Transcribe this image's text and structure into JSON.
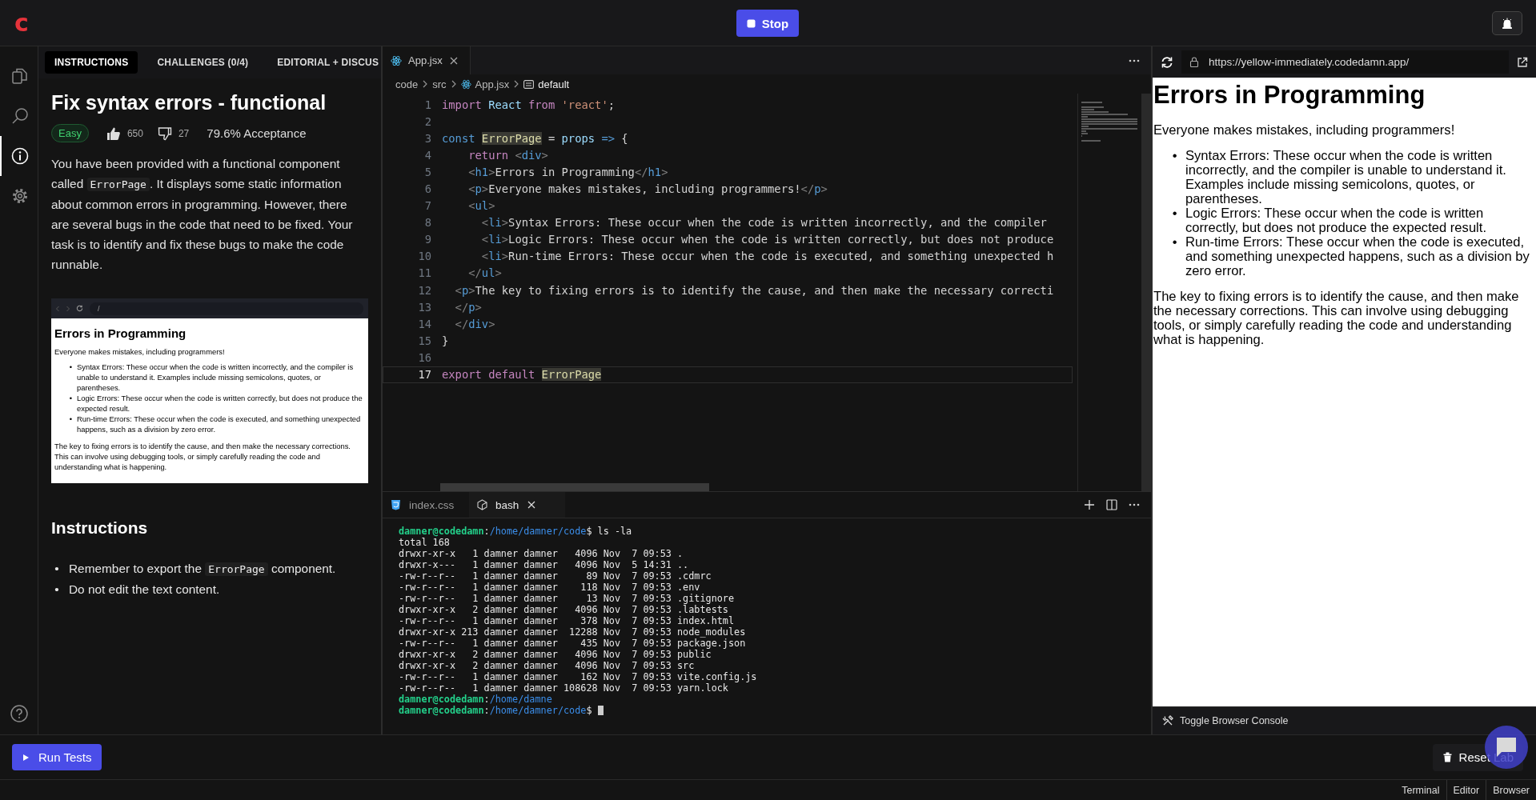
{
  "top_bar": {
    "brand": "c",
    "stop_button": "Stop"
  },
  "sidebar": {
    "items": [
      {
        "kind": "files",
        "selected": false
      },
      {
        "kind": "search",
        "selected": false
      },
      {
        "kind": "info",
        "selected": true
      },
      {
        "kind": "settings",
        "selected": false
      }
    ]
  },
  "instructions_panel": {
    "tabs": [
      {
        "label": "INSTRUCTIONS",
        "selected": true
      },
      {
        "label": "CHALLENGES (0/4)",
        "selected": false
      },
      {
        "label": "EDITORIAL + DISCUS",
        "selected": false
      }
    ],
    "title": "Fix syntax errors - functional",
    "difficulty": "Easy",
    "likes": "650",
    "dislikes": "27",
    "acceptance": "79.6% Acceptance",
    "description": [
      {
        "kind": "text",
        "text": "You have been provided with a functional component called "
      },
      {
        "kind": "code",
        "text": "ErrorPage"
      },
      {
        "kind": "text",
        "text": ". It displays some static information about common errors in programming. However, there are several bugs in the code that need to be fixed. Your task is to identify and fix these bugs to make the code runnable."
      }
    ],
    "screenshot": {
      "url": "/",
      "heading": "Errors in Programming",
      "intro": "Everyone makes mistakes, including programmers!",
      "bullet": "•",
      "items": [
        "Syntax Errors: These occur when the code is written incorrectly, and the compiler is unable to understand it. Examples include missing semicolons, quotes, or parentheses.",
        "Logic Errors: These occur when the code is written correctly, but does not produce the expected result.",
        "Run-time Errors: These occur when the code is executed, and something unexpected happens, such as a division by zero error."
      ],
      "closing": "The key to fixing errors is to identify the cause, and then make the necessary corrections. This can involve using debugging tools, or simply carefully reading the code and understanding what is happening."
    },
    "section_title": "Instructions",
    "step_bullet": "•",
    "steps": [
      [
        {
          "kind": "text",
          "text": "Remember to export the "
        },
        {
          "kind": "code",
          "text": "ErrorPage"
        },
        {
          "kind": "text",
          "text": " component."
        }
      ],
      [
        {
          "kind": "text",
          "text": "Do not edit the text content."
        }
      ]
    ]
  },
  "editor": {
    "tabs": [
      {
        "label": "App.jsx",
        "selected": true
      }
    ],
    "breadcrumb": [
      {
        "kind": "folder",
        "label": "code"
      },
      {
        "kind": "folder",
        "label": "src"
      },
      {
        "kind": "react",
        "label": "App.jsx"
      },
      {
        "kind": "symbol",
        "label": "default"
      }
    ],
    "lines": [
      {
        "number": "1",
        "current": false,
        "tokens": [
          {
            "kind": "kw",
            "text": "import "
          },
          {
            "kind": "var",
            "text": "React "
          },
          {
            "kind": "kw",
            "text": "from "
          },
          {
            "kind": "str",
            "text": "'react'"
          },
          {
            "kind": "text",
            "text": ";"
          }
        ]
      },
      {
        "number": "2",
        "current": false
      },
      {
        "number": "3",
        "current": false,
        "tokens": [
          {
            "kind": "decl",
            "text": "const "
          },
          {
            "kind": "hl",
            "text": "ErrorPage"
          },
          {
            "kind": "text",
            "text": " = "
          },
          {
            "kind": "var",
            "text": "props "
          },
          {
            "kind": "decl",
            "text": "=>"
          },
          {
            "kind": "text",
            "text": " {"
          }
        ]
      },
      {
        "number": "4",
        "current": false,
        "tokens": [
          {
            "kind": "kw",
            "text": "    return "
          },
          {
            "kind": "punct",
            "text": "<"
          },
          {
            "kind": "tag",
            "text": "div"
          },
          {
            "kind": "punct",
            "text": ">"
          }
        ]
      },
      {
        "number": "5",
        "current": false,
        "tokens": [
          {
            "kind": "punct",
            "text": "    <"
          },
          {
            "kind": "tag",
            "text": "h1"
          },
          {
            "kind": "punct",
            "text": ">"
          },
          {
            "kind": "text",
            "text": "Errors in Programming"
          },
          {
            "kind": "punct",
            "text": "</"
          },
          {
            "kind": "tag",
            "text": "h1"
          },
          {
            "kind": "punct",
            "text": ">"
          }
        ]
      },
      {
        "number": "6",
        "current": false,
        "tokens": [
          {
            "kind": "punct",
            "text": "    <"
          },
          {
            "kind": "tag",
            "text": "p"
          },
          {
            "kind": "punct",
            "text": ">"
          },
          {
            "kind": "text",
            "text": "Everyone makes mistakes, including programmers!"
          },
          {
            "kind": "punct",
            "text": "</"
          },
          {
            "kind": "tag",
            "text": "p"
          },
          {
            "kind": "punct",
            "text": ">"
          }
        ]
      },
      {
        "number": "7",
        "current": false,
        "tokens": [
          {
            "kind": "punct",
            "text": "    <"
          },
          {
            "kind": "tag",
            "text": "ul"
          },
          {
            "kind": "punct",
            "text": ">"
          }
        ]
      },
      {
        "number": "8",
        "current": false,
        "tokens": [
          {
            "kind": "punct",
            "text": "      <"
          },
          {
            "kind": "tag",
            "text": "li"
          },
          {
            "kind": "punct",
            "text": ">"
          },
          {
            "kind": "text",
            "text": "Syntax Errors: These occur when the code is written incorrectly, and the compiler"
          }
        ]
      },
      {
        "number": "9",
        "current": false,
        "tokens": [
          {
            "kind": "punct",
            "text": "      <"
          },
          {
            "kind": "tag",
            "text": "li"
          },
          {
            "kind": "punct",
            "text": ">"
          },
          {
            "kind": "text",
            "text": "Logic Errors: These occur when the code is written correctly, but does not produce"
          }
        ]
      },
      {
        "number": "10",
        "current": false,
        "tokens": [
          {
            "kind": "punct",
            "text": "      <"
          },
          {
            "kind": "tag",
            "text": "li"
          },
          {
            "kind": "punct",
            "text": ">"
          },
          {
            "kind": "text",
            "text": "Run-time Errors: These occur when the code is executed, and something unexpected h"
          }
        ]
      },
      {
        "number": "11",
        "current": false,
        "tokens": [
          {
            "kind": "punct",
            "text": "    </"
          },
          {
            "kind": "tag",
            "text": "ul"
          },
          {
            "kind": "punct",
            "text": ">"
          }
        ]
      },
      {
        "number": "12",
        "current": false,
        "tokens": [
          {
            "kind": "punct",
            "text": "  <"
          },
          {
            "kind": "tag",
            "text": "p"
          },
          {
            "kind": "punct",
            "text": ">"
          },
          {
            "kind": "text",
            "text": "The key to fixing errors is to identify the cause, and then make the necessary correcti"
          }
        ]
      },
      {
        "number": "13",
        "current": false,
        "tokens": [
          {
            "kind": "punct",
            "text": "  </"
          },
          {
            "kind": "tag",
            "text": "p"
          },
          {
            "kind": "punct",
            "text": ">"
          }
        ]
      },
      {
        "number": "14",
        "current": false,
        "tokens": [
          {
            "kind": "punct",
            "text": "  </"
          },
          {
            "kind": "tag",
            "text": "div"
          },
          {
            "kind": "punct",
            "text": ">"
          }
        ]
      },
      {
        "number": "15",
        "current": false,
        "tokens": [
          {
            "kind": "text",
            "text": "}"
          }
        ]
      },
      {
        "number": "16",
        "current": false
      },
      {
        "number": "17",
        "current": true,
        "tokens": [
          {
            "kind": "kw",
            "text": "export default "
          },
          {
            "kind": "hl",
            "text": "ErrorPage"
          }
        ]
      }
    ]
  },
  "terminal": {
    "tabs": [
      {
        "kind": "css",
        "label": "index.css",
        "selected": false
      },
      {
        "kind": "shell",
        "label": "bash",
        "selected": true
      }
    ],
    "lines": [
      {
        "kind": "prompt",
        "user": "damner@codedamn",
        "sep": ":",
        "path": "/home/damner/code",
        "rest": "$ ls -la",
        "cursor": false
      },
      {
        "kind": "output",
        "text": "total 168"
      },
      {
        "kind": "output",
        "text": "drwxr-xr-x   1 damner damner   4096 Nov  7 09:53 ."
      },
      {
        "kind": "output",
        "text": "drwxr-x---   1 damner damner   4096 Nov  5 14:31 .."
      },
      {
        "kind": "output",
        "text": "-rw-r--r--   1 damner damner     89 Nov  7 09:53 .cdmrc"
      },
      {
        "kind": "output",
        "text": "-rw-r--r--   1 damner damner    118 Nov  7 09:53 .env"
      },
      {
        "kind": "output",
        "text": "-rw-r--r--   1 damner damner     13 Nov  7 09:53 .gitignore"
      },
      {
        "kind": "output",
        "text": "drwxr-xr-x   2 damner damner   4096 Nov  7 09:53 .labtests"
      },
      {
        "kind": "output",
        "text": "-rw-r--r--   1 damner damner    378 Nov  7 09:53 index.html"
      },
      {
        "kind": "output",
        "text": "drwxr-xr-x 213 damner damner  12288 Nov  7 09:53 node_modules"
      },
      {
        "kind": "output",
        "text": "-rw-r--r--   1 damner damner    435 Nov  7 09:53 package.json"
      },
      {
        "kind": "output",
        "text": "drwxr-xr-x   2 damner damner   4096 Nov  7 09:53 public"
      },
      {
        "kind": "output",
        "text": "drwxr-xr-x   2 damner damner   4096 Nov  7 09:53 src"
      },
      {
        "kind": "output",
        "text": "-rw-r--r--   1 damner damner    162 Nov  7 09:53 vite.config.js"
      },
      {
        "kind": "output",
        "text": "-rw-r--r--   1 damner damner 108628 Nov  7 09:53 yarn.lock"
      },
      {
        "kind": "prompt",
        "user": "damner@codedamn",
        "sep": ":",
        "path": "/home/damne",
        "cursor": false
      },
      {
        "kind": "prompt",
        "user": "damner@codedamn",
        "sep": ":",
        "path": "/home/damner/code",
        "rest": "$",
        "cursor": true
      }
    ]
  },
  "browser": {
    "url": "https://yellow-immediately.codedamn.app/",
    "heading": "Errors in Programming",
    "intro": "Everyone makes mistakes, including programmers!",
    "bullet": "•",
    "items": [
      "Syntax Errors: These occur when the code is written incorrectly, and the compiler is unable to understand it. Examples include missing semicolons, quotes, or parentheses.",
      "Logic Errors: These occur when the code is written correctly, but does not produce the expected result.",
      "Run-time Errors: These occur when the code is executed, and something unexpected happens, such as a division by zero error."
    ],
    "closing": "The key to fixing errors is to identify the cause, and then make the necessary corrections. This can involve using debugging tools, or simply carefully reading the code and understanding what is happening.",
    "console_toggle": "Toggle Browser Console"
  },
  "footer": {
    "run_tests": "Run Tests",
    "reset": "Reset Lab"
  },
  "status_bar": {
    "views": [
      "Terminal",
      "Editor",
      "Browser"
    ]
  }
}
